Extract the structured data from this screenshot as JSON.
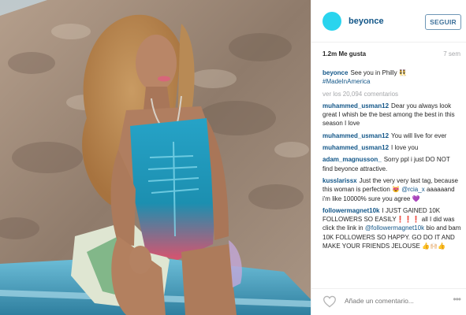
{
  "post": {
    "photo_description_icon": "photo",
    "account_username": "beyonce",
    "follow_label": "SEGUIR",
    "likes_text": "1.2m Me gusta",
    "time_ago": "7 sem",
    "caption": {
      "user": "beyonce",
      "text": "See you in Philly",
      "emoji": "👯",
      "hashtag": "#MadeInAmerica"
    },
    "view_all_comments": "ver los 20,094 comentarios",
    "comments": [
      {
        "user": "muhammed_usman12",
        "text": "Dear you always look great I whish be the best among the best in this season I love"
      },
      {
        "user": "muhammed_usman12",
        "text": "You will live for ever"
      },
      {
        "user": "muhammed_usman12",
        "text": "I love you"
      },
      {
        "user": "adam_magnusson_",
        "text": "Sorry ppl i just DO NOT find beyonce attractive."
      },
      {
        "user": "kusslarissx",
        "text": "Just the very very last tag, because this woman is perfection 😻",
        "mention": "@rcia_x",
        "text2": "aaaaaand i'm like 10000% sure you agree 💜"
      },
      {
        "user": "followermagnet10k",
        "text": "I JUST GAINED 10K FOLLOWERS SO EASILY❗️❗️❗️ all I did was click the link in",
        "mention": "@followermagnet10k",
        "text2": "bio and bam 10K FOLLOWERS SO HAPPY. GO DO IT AND MAKE YOUR FRIENDS JELOUSE 👍🙌🏻👍"
      }
    ],
    "add_comment_placeholder": "Añade un comentario...",
    "more_options": "•••"
  }
}
